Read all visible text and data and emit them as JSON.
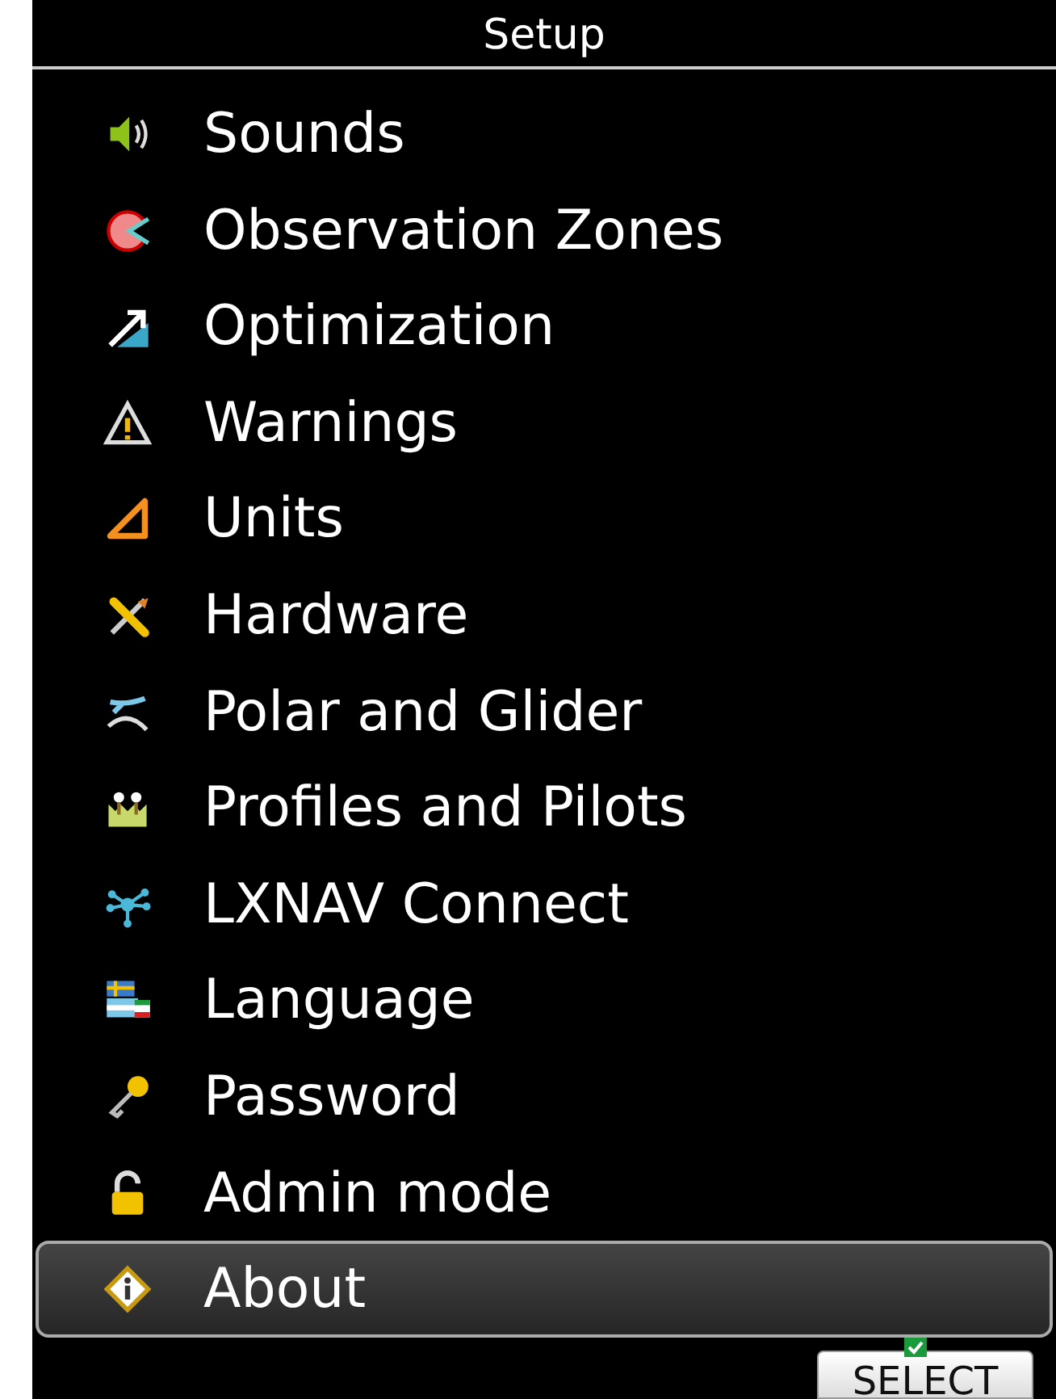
{
  "window": {
    "title": "Setup"
  },
  "menu": {
    "items": [
      {
        "label": "Sounds",
        "selected": false
      },
      {
        "label": "Observation Zones",
        "selected": false
      },
      {
        "label": "Optimization",
        "selected": false
      },
      {
        "label": "Warnings",
        "selected": false
      },
      {
        "label": "Units",
        "selected": false
      },
      {
        "label": "Hardware",
        "selected": false
      },
      {
        "label": "Polar and Glider",
        "selected": false
      },
      {
        "label": "Profiles and Pilots",
        "selected": false
      },
      {
        "label": "LXNAV Connect",
        "selected": false
      },
      {
        "label": "Language",
        "selected": false
      },
      {
        "label": "Password",
        "selected": false
      },
      {
        "label": "Admin mode",
        "selected": false
      },
      {
        "label": "About",
        "selected": true
      }
    ]
  },
  "buttons": [
    {
      "label": "SELECT"
    }
  ]
}
